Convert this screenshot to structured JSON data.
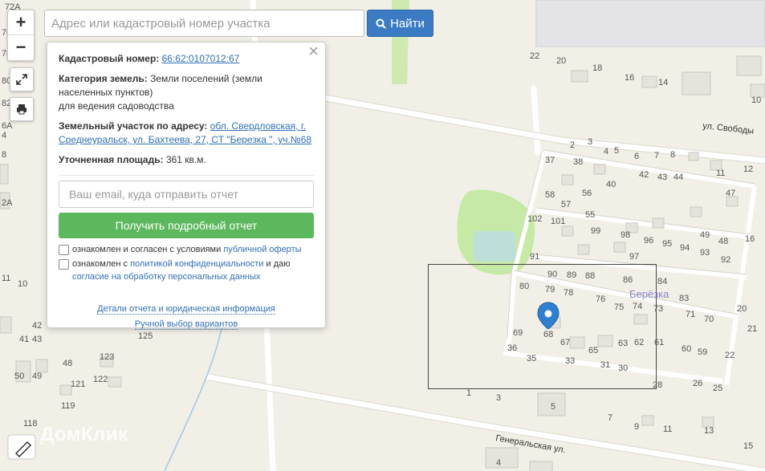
{
  "search": {
    "placeholder": "Адрес или кадастровый номер участка",
    "button_label": "Найти"
  },
  "zoom": {
    "in": "+",
    "out": "−"
  },
  "popup": {
    "cadastral_label": "Кадастровый номер:",
    "cadastral_number": "66:62:0107012:67",
    "category_label": "Категория земель:",
    "category_value": "Земли поселений (земли населенных пунктов)",
    "category_use": "для ведения садоводства",
    "address_label": "Земельный участок по адресу:",
    "address_value": "обл. Свердловская, г. Среднеуральск, ул. Бахтеева, 27, СТ \"Березка \", уч.№68",
    "area_label": "Уточненная площадь:",
    "area_value": "361 кв.м.",
    "email_placeholder": "Ваш email, куда отправить отчет",
    "report_button": "Получить подробный отчет",
    "consent1_text": "ознакомлен и согласен с условиями",
    "consent1_link": "публичной оферты",
    "consent2_text": "ознакомлен с",
    "consent2_link": "политикой конфиденциальности",
    "consent2_and": "и даю",
    "consent2_link2": "согласие на обработку персональных данных",
    "details_link": "Детали отчета и юридическая информация",
    "manual_link": "Ручной выбор вариантов",
    "close": "×"
  },
  "map": {
    "streets": [
      "ул. Свободы",
      "Генеральская ул."
    ],
    "area_name": "Берёзка",
    "logo": "ДомКлик",
    "marker_number": "68",
    "house_numbers": [
      {
        "n": "72А"
      },
      {
        "n": "76"
      },
      {
        "n": "78"
      },
      {
        "n": "80"
      },
      {
        "n": "82"
      },
      {
        "n": "6А"
      },
      {
        "n": "4"
      },
      {
        "n": "8"
      },
      {
        "n": "2А"
      },
      {
        "n": "11"
      },
      {
        "n": "10"
      },
      {
        "n": "42"
      },
      {
        "n": "43"
      },
      {
        "n": "41"
      },
      {
        "n": "48"
      },
      {
        "n": "123"
      },
      {
        "n": "125"
      },
      {
        "n": "50"
      },
      {
        "n": "49"
      },
      {
        "n": "121"
      },
      {
        "n": "122"
      },
      {
        "n": "119"
      },
      {
        "n": "118"
      },
      {
        "n": "22"
      },
      {
        "n": "20"
      },
      {
        "n": "18"
      },
      {
        "n": "16"
      },
      {
        "n": "14"
      },
      {
        "n": "10"
      },
      {
        "n": "2"
      },
      {
        "n": "3"
      },
      {
        "n": "4"
      },
      {
        "n": "5"
      },
      {
        "n": "6"
      },
      {
        "n": "7"
      },
      {
        "n": "8"
      },
      {
        "n": "37"
      },
      {
        "n": "38"
      },
      {
        "n": "42"
      },
      {
        "n": "43"
      },
      {
        "n": "44"
      },
      {
        "n": "11"
      },
      {
        "n": "12"
      },
      {
        "n": "40"
      },
      {
        "n": "58"
      },
      {
        "n": "56"
      },
      {
        "n": "47"
      },
      {
        "n": "57"
      },
      {
        "n": "55"
      },
      {
        "n": "102"
      },
      {
        "n": "101"
      },
      {
        "n": "99"
      },
      {
        "n": "98"
      },
      {
        "n": "96"
      },
      {
        "n": "95"
      },
      {
        "n": "94"
      },
      {
        "n": "93"
      },
      {
        "n": "49"
      },
      {
        "n": "48"
      },
      {
        "n": "16"
      },
      {
        "n": "97"
      },
      {
        "n": "92"
      },
      {
        "n": "91"
      },
      {
        "n": "90"
      },
      {
        "n": "89"
      },
      {
        "n": "88"
      },
      {
        "n": "86"
      },
      {
        "n": "84"
      },
      {
        "n": "80"
      },
      {
        "n": "79"
      },
      {
        "n": "78"
      },
      {
        "n": "76"
      },
      {
        "n": "75"
      },
      {
        "n": "74"
      },
      {
        "n": "73"
      },
      {
        "n": "83"
      },
      {
        "n": "71"
      },
      {
        "n": "70"
      },
      {
        "n": "69"
      },
      {
        "n": "67"
      },
      {
        "n": "65"
      },
      {
        "n": "63"
      },
      {
        "n": "62"
      },
      {
        "n": "61"
      },
      {
        "n": "60"
      },
      {
        "n": "59"
      },
      {
        "n": "36"
      },
      {
        "n": "35"
      },
      {
        "n": "33"
      },
      {
        "n": "31"
      },
      {
        "n": "30"
      },
      {
        "n": "28"
      },
      {
        "n": "26"
      },
      {
        "n": "25"
      },
      {
        "n": "22"
      },
      {
        "n": "21"
      },
      {
        "n": "20"
      },
      {
        "n": "1"
      },
      {
        "n": "3"
      },
      {
        "n": "5"
      },
      {
        "n": "7"
      },
      {
        "n": "9"
      },
      {
        "n": "11"
      },
      {
        "n": "13"
      },
      {
        "n": "15"
      },
      {
        "n": "4"
      }
    ]
  },
  "colors": {
    "accent": "#3a7bc4",
    "green": "#5cb85c",
    "link": "#2f6fb5",
    "park": "#bfe6a4",
    "water": "#b9dde0",
    "marker": "#2f7fd0"
  }
}
